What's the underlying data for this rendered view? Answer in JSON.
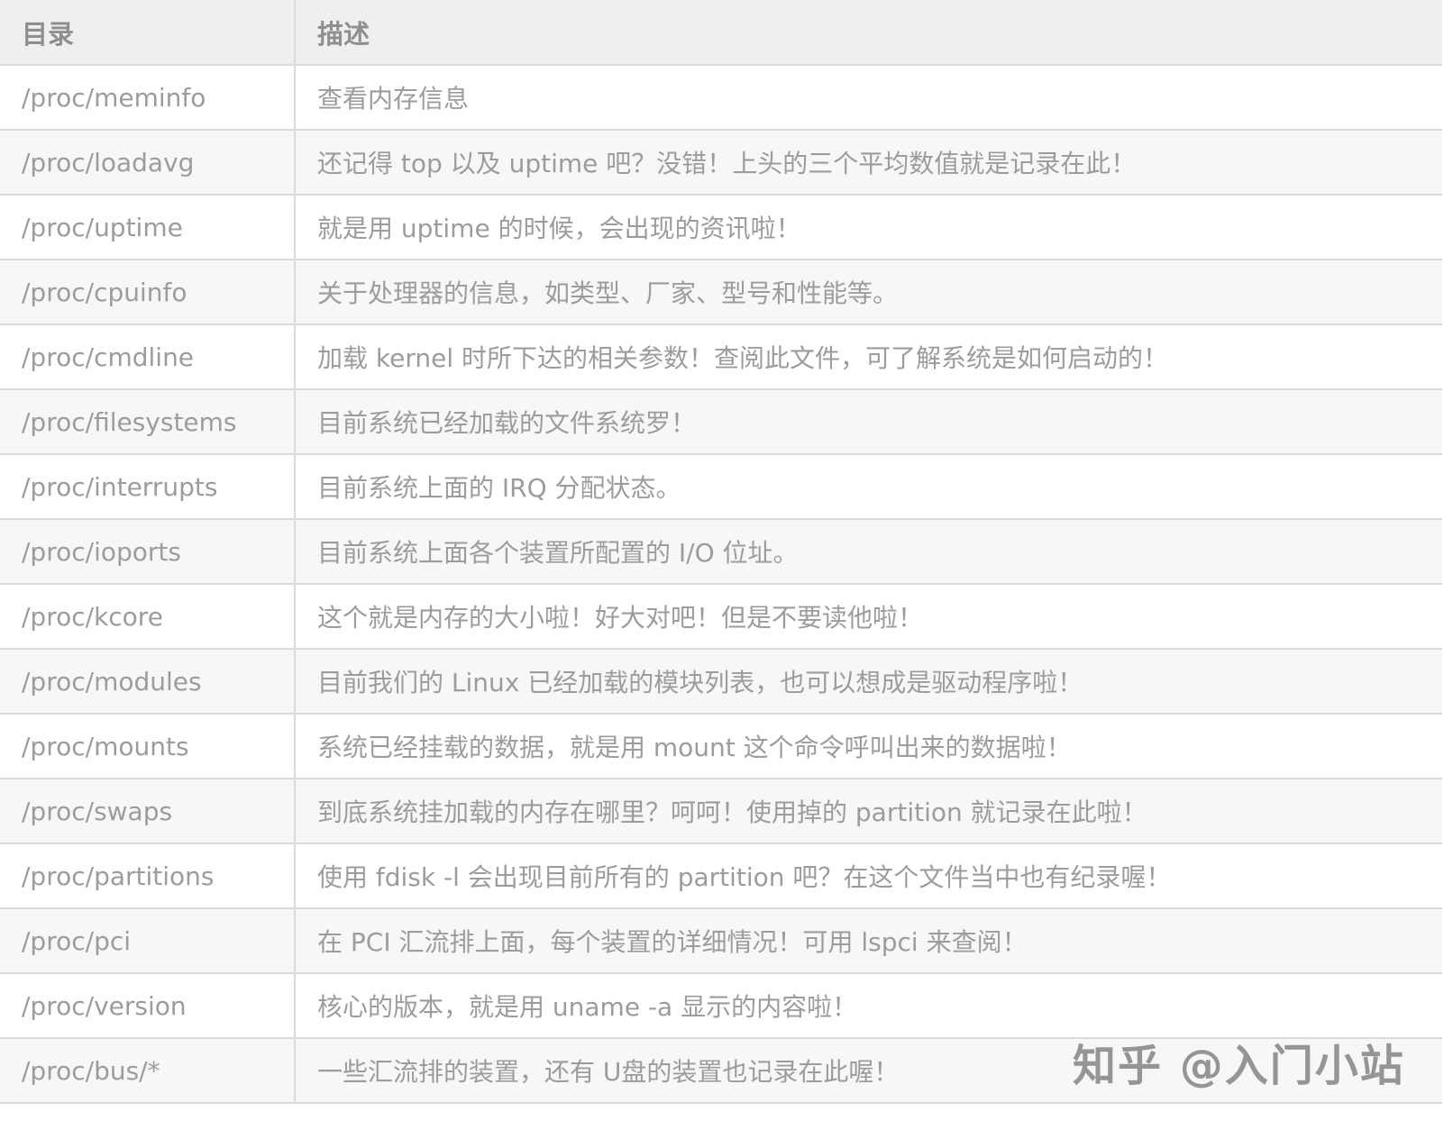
{
  "table": {
    "headers": [
      "目录",
      "描述"
    ],
    "rows": [
      {
        "path": "/proc/meminfo",
        "desc": "查看内存信息"
      },
      {
        "path": "/proc/loadavg",
        "desc": "还记得 top 以及 uptime 吧？没错！上头的三个平均数值就是记录在此！"
      },
      {
        "path": "/proc/uptime",
        "desc": "就是用 uptime 的时候，会出现的资讯啦！"
      },
      {
        "path": "/proc/cpuinfo",
        "desc": "关于处理器的信息，如类型、厂家、型号和性能等。"
      },
      {
        "path": "/proc/cmdline",
        "desc": "加载 kernel 时所下达的相关参数！查阅此文件，可了解系统是如何启动的！"
      },
      {
        "path": "/proc/filesystems",
        "desc": "目前系统已经加载的文件系统罗！"
      },
      {
        "path": "/proc/interrupts",
        "desc": "目前系统上面的 IRQ 分配状态。"
      },
      {
        "path": "/proc/ioports",
        "desc": "目前系统上面各个装置所配置的 I/O 位址。"
      },
      {
        "path": "/proc/kcore",
        "desc": "这个就是内存的大小啦！好大对吧！但是不要读他啦！"
      },
      {
        "path": "/proc/modules",
        "desc": "目前我们的 Linux 已经加载的模块列表，也可以想成是驱动程序啦！"
      },
      {
        "path": "/proc/mounts",
        "desc": "系统已经挂载的数据，就是用 mount 这个命令呼叫出来的数据啦！"
      },
      {
        "path": "/proc/swaps",
        "desc": "到底系统挂加载的内存在哪里？呵呵！使用掉的 partition 就记录在此啦！"
      },
      {
        "path": "/proc/partitions",
        "desc": "使用 fdisk -l 会出现目前所有的 partition 吧？在这个文件当中也有纪录喔！"
      },
      {
        "path": "/proc/pci",
        "desc": "在 PCI 汇流排上面，每个装置的详细情况！可用 lspci 来查阅！"
      },
      {
        "path": "/proc/version",
        "desc": "核心的版本，就是用 uname -a 显示的内容啦！"
      },
      {
        "path": "/proc/bus/*",
        "desc": "一些汇流排的装置，还有 U盘的装置也记录在此喔！"
      }
    ]
  },
  "watermark": {
    "text": "知乎 @入门小站"
  }
}
